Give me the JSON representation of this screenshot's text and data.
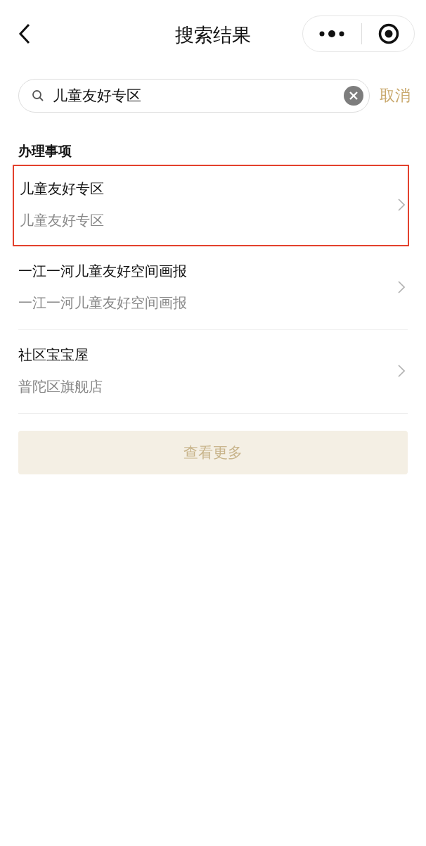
{
  "header": {
    "title": "搜索结果"
  },
  "search": {
    "value": "儿童友好专区",
    "cancel": "取消"
  },
  "section": {
    "title": "办理事项"
  },
  "results": [
    {
      "title": "儿童友好专区",
      "subtitle": "儿童友好专区",
      "highlighted": true
    },
    {
      "title": "一江一河儿童友好空间画报",
      "subtitle": "一江一河儿童友好空间画报",
      "highlighted": false
    },
    {
      "title": "社区宝宝屋",
      "subtitle": "普陀区旗舰店",
      "highlighted": false
    }
  ],
  "more_button": "查看更多"
}
